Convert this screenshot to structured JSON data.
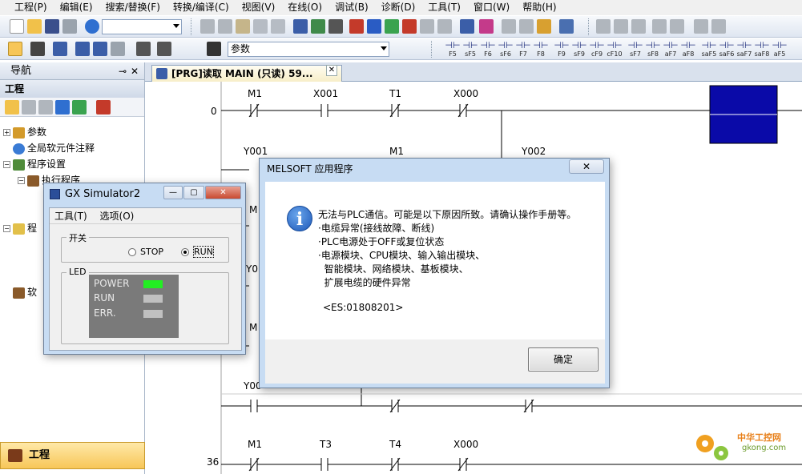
{
  "menu": [
    "工程(P)",
    "编辑(E)",
    "搜索/替换(F)",
    "转换/编译(C)",
    "视图(V)",
    "在线(O)",
    "调试(B)",
    "诊断(D)",
    "工具(T)",
    "窗口(W)",
    "帮助(H)"
  ],
  "toolbar": {
    "search_value": "参数",
    "fkeys": [
      "F5",
      "sF5",
      "F6",
      "sF6",
      "F7",
      "F8",
      "F9",
      "sF9",
      "cF9",
      "cF10",
      "sF7",
      "sF8",
      "aF7",
      "aF8",
      "saF5",
      "saF6",
      "saF7",
      "saF8",
      "aF5"
    ]
  },
  "navigator": {
    "title": "导航",
    "section": "工程",
    "tree": [
      "参数",
      "全局软元件注释",
      "程序设置",
      "执行程序",
      "程",
      "软"
    ],
    "bottom_button": "工程"
  },
  "tab": {
    "title": "[PRG]读取 MAIN (只读) 59..."
  },
  "ladder": {
    "step_numbers": [
      "0",
      "36"
    ],
    "row1": [
      "M1",
      "X001",
      "T1",
      "X000"
    ],
    "row2": [
      "Y001",
      "M1",
      "Y002"
    ],
    "row_mid": [
      "M",
      "Y0",
      "M"
    ],
    "row_y": "Y00",
    "row_last": [
      "M1",
      "T3",
      "T4",
      "X000"
    ]
  },
  "simulator": {
    "title": "GX Simulator2",
    "menu": [
      "工具(T)",
      "选项(O)"
    ],
    "switch_label": "开关",
    "stop_label": "STOP",
    "run_label": "RUN",
    "led_label": "LED",
    "leds": [
      {
        "name": "POWER",
        "color": "#22ee22"
      },
      {
        "name": "RUN",
        "color": "#c0c0c0"
      },
      {
        "name": "ERR.",
        "color": "#c0c0c0"
      }
    ]
  },
  "message": {
    "title": "MELSOFT 应用程序",
    "lines": [
      "无法与PLC通信。可能是以下原因所致。请确认操作手册等。",
      "·电缆异常(接线故障、断线)",
      "·PLC电源处于OFF或复位状态",
      "·电源模块、CPU模块、输入输出模块、",
      "  智能模块、网络模块、基板模块、",
      "  扩展电缆的硬件异常"
    ],
    "code": "<ES:01808201>",
    "ok_label": "确定"
  },
  "watermark": {
    "text": "中华工控网",
    "sub": "gkong.com"
  }
}
